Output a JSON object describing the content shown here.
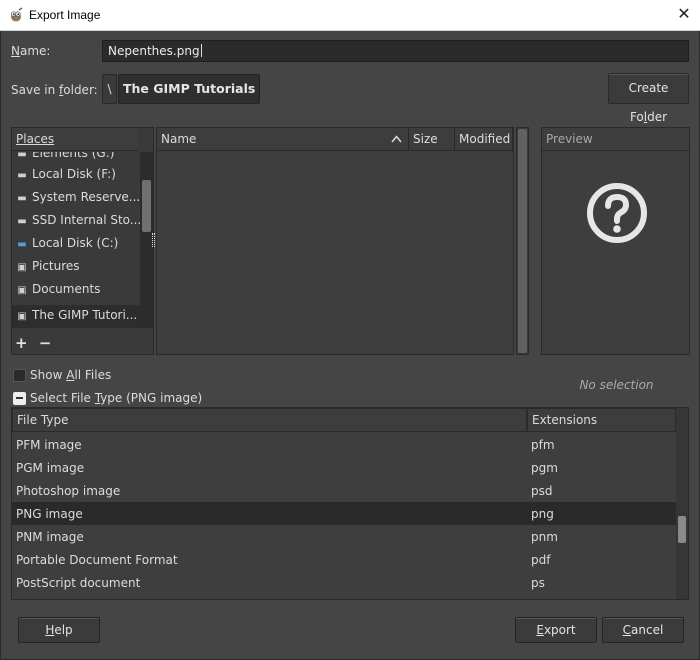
{
  "window": {
    "title": "Export Image",
    "close_glyph": "✕",
    "app_icon": "gimp-icon"
  },
  "name_field": {
    "label_prefix": "",
    "label_u": "N",
    "label_rest": "ame:",
    "value": "Nepenthes.png"
  },
  "save_folder": {
    "label_a": "Save in ",
    "label_u": "f",
    "label_b": "older:",
    "separator": "\\",
    "breadcrumb": "The GIMP Tutorials",
    "create_folder_a": "Create Fo",
    "create_folder_u": "l",
    "create_folder_b": "der"
  },
  "places": {
    "header": "Places",
    "items": [
      {
        "label": "Elements (G:)",
        "icon": "drive-icon"
      },
      {
        "label": "Local Disk (F:)",
        "icon": "drive-icon"
      },
      {
        "label": "System Reserve...",
        "icon": "drive-icon"
      },
      {
        "label": "SSD Internal Sto...",
        "icon": "drive-icon"
      },
      {
        "label": "Local Disk (C:)",
        "icon": "system-drive-icon"
      },
      {
        "label": "Pictures",
        "icon": "folder-icon"
      },
      {
        "label": "Documents",
        "icon": "folder-icon"
      },
      {
        "label": "The GIMP Tutori...",
        "icon": "folder-icon"
      }
    ],
    "add_glyph": "+",
    "remove_glyph": "−"
  },
  "files": {
    "columns": {
      "name": "Name",
      "size": "Size",
      "modified": "Modified"
    },
    "sort_glyph": "^"
  },
  "preview": {
    "header": "Preview",
    "empty_text": "No selection"
  },
  "show_all_files": {
    "label_a": "Show ",
    "label_u": "A",
    "label_b": "ll Files"
  },
  "select_file_type": {
    "label_a": "Select File ",
    "label_u": "T",
    "label_b": "ype (PNG image)"
  },
  "file_types": {
    "columns": {
      "type": "File Type",
      "ext": "Extensions"
    },
    "rows": [
      {
        "type": "PFM image",
        "ext": "pfm"
      },
      {
        "type": "PGM image",
        "ext": "pgm"
      },
      {
        "type": "Photoshop image",
        "ext": "psd"
      },
      {
        "type": "PNG image",
        "ext": "png"
      },
      {
        "type": "PNM image",
        "ext": "pnm"
      },
      {
        "type": "Portable Document Format",
        "ext": "pdf"
      },
      {
        "type": "PostScript document",
        "ext": "ps"
      }
    ],
    "selected": "PNG image"
  },
  "buttons": {
    "help_u": "H",
    "help_rest": "elp",
    "export_u": "E",
    "export_rest": "xport",
    "cancel_u": "C",
    "cancel_rest": "ancel"
  }
}
